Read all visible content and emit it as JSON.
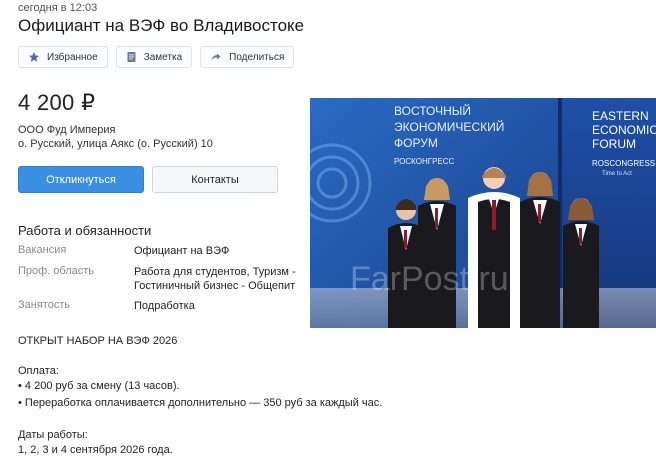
{
  "posted": "сегодня в 12:03",
  "title": "Официант на ВЭФ во Владивостоке",
  "actions": {
    "favorite": "Избранное",
    "note": "Заметка",
    "share": "Поделиться"
  },
  "price": "4 200 ₽",
  "company": "ООО Фуд Империя",
  "address": "о. Русский, улица Аякс (о. Русский) 10",
  "buttons": {
    "respond": "Откликнуться",
    "contacts": "Контакты"
  },
  "section": {
    "title": "Работа и обязанности",
    "rows": [
      {
        "label": "Вакансия",
        "value": "Официант на ВЭФ"
      },
      {
        "label": "Проф. область",
        "value": "Работа для студентов, Туризм - Гостиничный бизнес - Общепит"
      },
      {
        "label": "Занятость",
        "value": "Подработка"
      }
    ]
  },
  "description": {
    "headline": "ОТКРЫТ НАБОР НА ВЭФ 2026",
    "pay_title": "Оплата:",
    "pay_lines": [
      "• 4 200 руб за смену (13 часов).",
      "• Переработка оплачивается дополнительно — 350 руб за каждый час."
    ],
    "dates_title": "Даты работы:",
    "dates_value": "1, 2, 3 и 4 сентября 2026 года."
  },
  "photo": {
    "banner_left": [
      "ВОСТОЧНЫЙ",
      "ЭКОНОМИЧЕСКИЙ",
      "ФОРУМ"
    ],
    "banner_left_sub": "РОСКОНГРЕСС",
    "banner_right": [
      "EASTERN",
      "ECONOMIC",
      "FORUM"
    ],
    "banner_right_sub": "ROSCONGRESS",
    "banner_right_sub2": "Time to Act",
    "watermark": "FarPost.ru"
  },
  "colors": {
    "primary_button": "#3b8fe2",
    "banner_blue": "#1e4fa3"
  }
}
